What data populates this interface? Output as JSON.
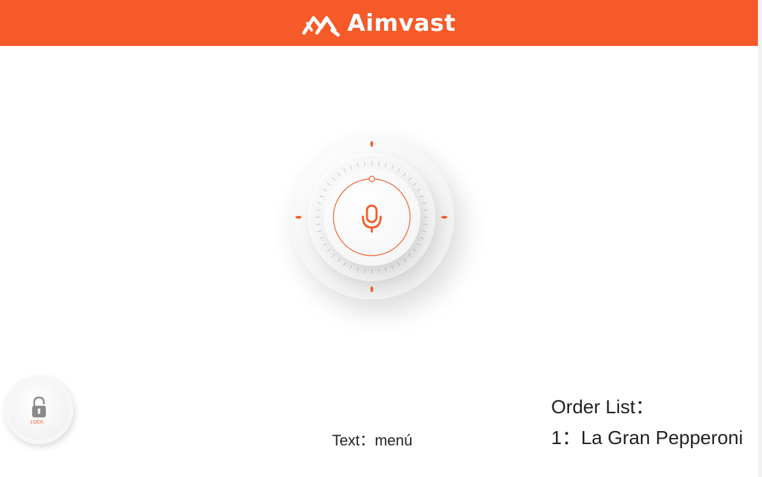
{
  "header": {
    "brand_name": "Aimvast",
    "background_color": "#f55a28",
    "logo_icon": "aimvast-logo-icon"
  },
  "voice_dial": {
    "icon": "microphone-icon",
    "accent_color": "#f55a28"
  },
  "lock_button": {
    "icon": "padlock-icon",
    "label": "LOCK"
  },
  "recognized_text": {
    "text": "Text：menú"
  },
  "order_list": {
    "title": "Order List：",
    "items": [
      {
        "label": "1：La Gran Pepperoni"
      }
    ]
  }
}
